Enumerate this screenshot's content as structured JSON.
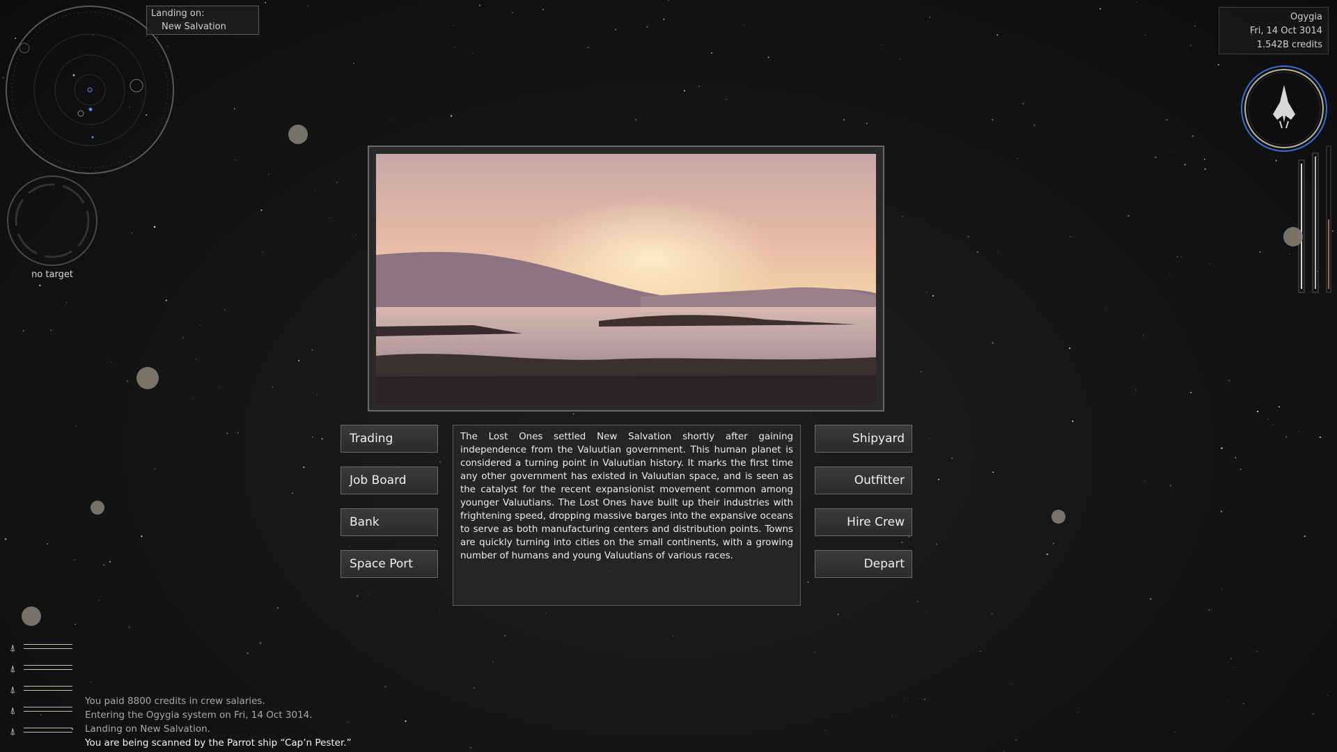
{
  "landing": {
    "label": "Landing on:",
    "planet": "New Salvation"
  },
  "system_info": {
    "system": "Ogygia",
    "date": "Fri, 14 Oct 3014",
    "credits": "1.542B credits"
  },
  "target": {
    "label": "no target"
  },
  "planet": {
    "description": "The Lost Ones settled New Salvation shortly after gaining independence from the Valuutian government. This human planet is considered a turning point in Valuutian history. It marks the first time any other government has existed in Valuutian space, and is seen as the catalyst for the recent expansionist movement common among younger Valuutians. The Lost Ones have built up their industries with frightening speed, dropping massive barges into the expansive oceans to serve as both manufacturing centers and distribution points. Towns are quickly turning into cities on the small continents, with a growing number of humans and young Valuutians of various races."
  },
  "buttons": {
    "trading": "Trading",
    "job_board": "Job Board",
    "bank": "Bank",
    "space_port": "Space Port",
    "shipyard": "Shipyard",
    "outfitter": "Outfitter",
    "hire_crew": "Hire Crew",
    "depart": "Depart"
  },
  "messages": [
    "You paid 8800 credits in crew salaries.",
    "Entering the Ogygia system on Fri, 14 Oct 3014.",
    "Landing on New Salvation.",
    "You are being scanned by the Parrot ship “Cap’n Pester.”"
  ],
  "colors": {
    "accent_ring": "#3a6fd8",
    "button_text": "#f0f0f0"
  }
}
